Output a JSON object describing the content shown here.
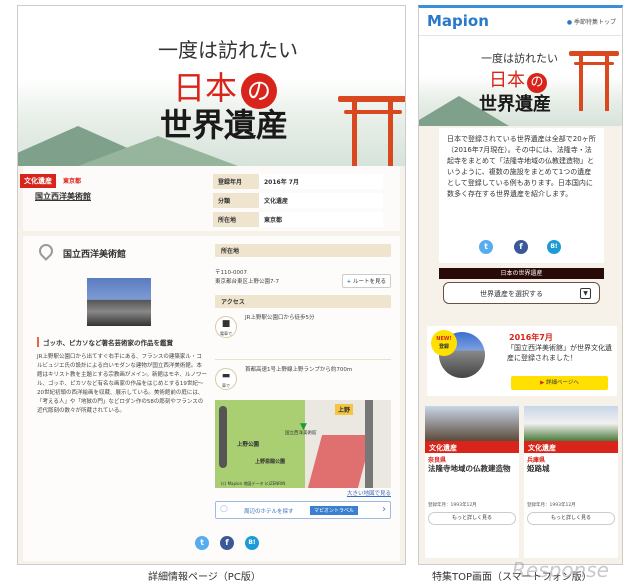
{
  "pc": {
    "hero": {
      "line1": "一度は訪れたい",
      "line2a": "日本",
      "line2b": "の",
      "line3": "世界遺産"
    },
    "info": {
      "tag": "文化遺産",
      "prefecture": "東京都",
      "title": "国立西洋美術館",
      "rows": [
        {
          "label": "登録年月",
          "value": "2016年 7月"
        },
        {
          "label": "分類",
          "value": "文化遺産"
        },
        {
          "label": "所在地",
          "value": "東京都"
        }
      ]
    },
    "detail": {
      "title": "国立西洋美術館",
      "subtitle": "ゴッホ、ピカソなど著名芸術家の作品を鑑賞",
      "body": "JR上野駅公園口から出てすぐ右手にある、フランスの建築家ル・コルビュジエ氏の設計による白いモダンな建物が国立西洋美術館。本館はキリスト教を主題とする宗教画がメイン。新館はモネ、ルノワール、ゴッホ、ピカソなど有名な画家の作品をはじめとする19世紀～20世紀初頭の西洋絵画を収蔵、展示している。美術館前の庭には、「考える人」や「地獄の門」などロダン作の58の彫刻やフランスの近代彫刻の数々が所蔵されている。",
      "location_header": "所在地",
      "postal": "〒110-0007",
      "address": "東京都台東区上野公園7-7",
      "route_button": "ルートを見る",
      "access_header": "アクセス",
      "access": [
        {
          "mode": "電車で",
          "text": "JR上野駅公園口から徒歩5分"
        },
        {
          "mode": "車で",
          "text": "首都高速1号上野線上野ランプから約700m"
        }
      ],
      "map": {
        "labels": [
          "上野",
          "上野公園",
          "上野恩賜公園",
          "国立西洋美術館"
        ],
        "copyright": "(c) Mapion 地図データ (c)ZENRIN",
        "large_map_link": "大きい地図で見る"
      },
      "hotel": {
        "text": "周辺のホテルを探す",
        "badge": "マピオントラベル"
      },
      "sns": [
        "t",
        "f",
        "B!"
      ]
    },
    "caption": "詳細情報ページ（PC版）"
  },
  "sp": {
    "logo": "Mapion",
    "top_link": "季節特集トップ",
    "hero": {
      "line1": "一度は訪れたい",
      "line2a": "日本",
      "line2b": "の",
      "line3": "世界遺産"
    },
    "intro": "日本で登録されている世界遺産は全部で20ヶ所（2016年7月現在）。その中には、法隆寺・法起寺をまとめて「法隆寺地域の仏教建造物」というように、複数の施設をまとめて1つの遺産として登録している例もあります。日本国内に数多く存在する世界遺産を紹介します。",
    "sns": [
      "t",
      "f",
      "B!"
    ],
    "section_title": "日本の世界遺産",
    "select": "世界遺産を選択する",
    "news": {
      "badge1": "NEW!",
      "badge2": "登録",
      "date": "2016年7月",
      "text": "「国立西洋美術館」が世界文化遺産に登録されました！",
      "button": "詳細ページへ"
    },
    "cards": [
      {
        "tag": "文化遺産",
        "pref": "奈良県",
        "name": "法隆寺地域の仏教建造物",
        "date": "登録年月：1993年12月",
        "button": "もっと詳しく見る"
      },
      {
        "tag": "文化遺産",
        "pref": "兵庫県",
        "name": "姫路城",
        "date": "登録年月：1993年12月",
        "button": "もっと詳しく見る"
      }
    ],
    "caption": "特集TOP画面（スマートフォン版）"
  },
  "watermark": "Response"
}
